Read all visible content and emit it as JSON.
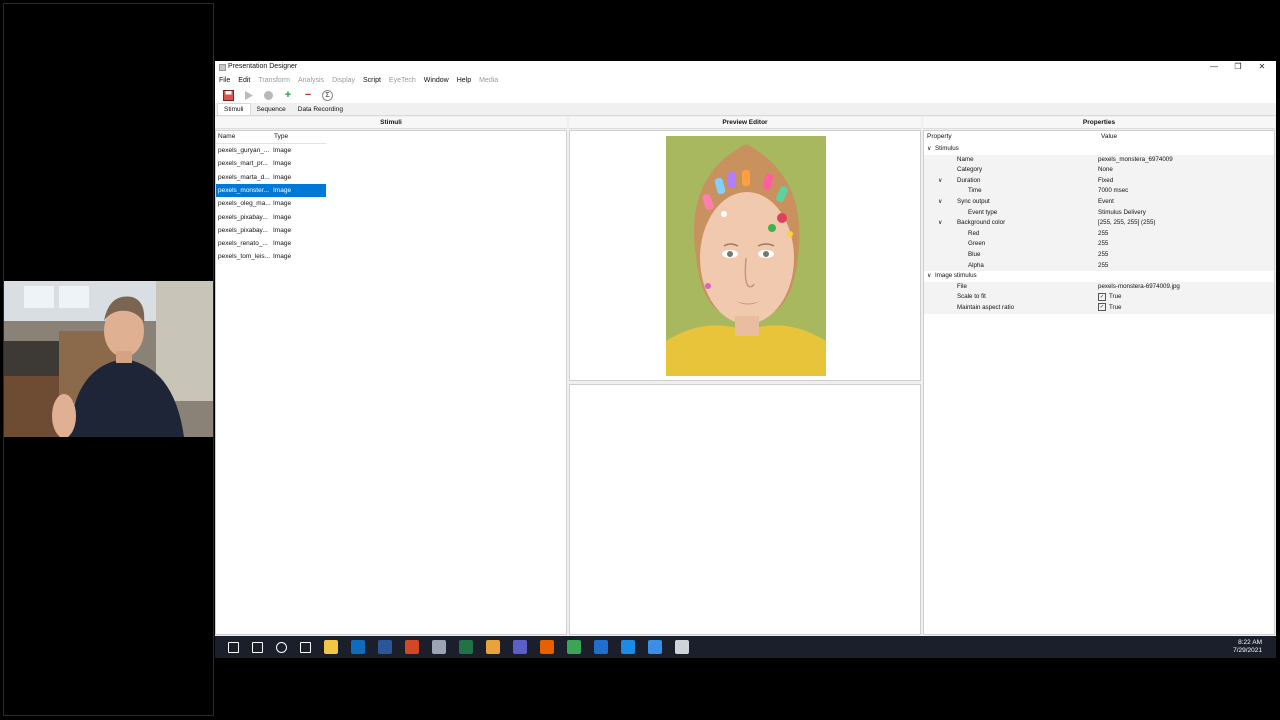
{
  "window": {
    "title": "Presentation Designer",
    "controls": [
      "—",
      "❐",
      "✕"
    ]
  },
  "menu": {
    "items": [
      {
        "label": "File",
        "enabled": true
      },
      {
        "label": "Edit",
        "enabled": true
      },
      {
        "label": "Transform",
        "enabled": false
      },
      {
        "label": "Analysis",
        "enabled": false
      },
      {
        "label": "Display",
        "enabled": false
      },
      {
        "label": "Script",
        "enabled": true
      },
      {
        "label": "EyeTech",
        "enabled": false
      },
      {
        "label": "Window",
        "enabled": true
      },
      {
        "label": "Help",
        "enabled": true
      },
      {
        "label": "Media",
        "enabled": false
      }
    ]
  },
  "toolbar": {
    "icons": [
      "save-icon",
      "play-icon",
      "record-icon",
      "add-icon",
      "remove-icon",
      "sigma-icon"
    ],
    "add_glyph": "+",
    "remove_glyph": "−",
    "sigma_glyph": "Σ"
  },
  "tabs": [
    {
      "label": "Stimuli",
      "active": true
    },
    {
      "label": "Sequence",
      "active": false
    },
    {
      "label": "Data Recording",
      "active": false
    }
  ],
  "stimuli": {
    "header": "Stimuli",
    "columns": [
      "Name",
      "Type"
    ],
    "rows": [
      {
        "name": "pexels_guryan_...",
        "type": "Image",
        "selected": false
      },
      {
        "name": "pexels_mart_pr...",
        "type": "Image",
        "selected": false
      },
      {
        "name": "pexels_marta_d...",
        "type": "Image",
        "selected": false
      },
      {
        "name": "pexels_monster...",
        "type": "Image",
        "selected": true
      },
      {
        "name": "pexels_oleg_ma...",
        "type": "Image",
        "selected": false
      },
      {
        "name": "pexels_pixabay...",
        "type": "Image",
        "selected": false
      },
      {
        "name": "pexels_pixabay...",
        "type": "Image",
        "selected": false
      },
      {
        "name": "pexels_renato_...",
        "type": "Image",
        "selected": false
      },
      {
        "name": "pexels_tom_leis...",
        "type": "Image",
        "selected": false
      }
    ]
  },
  "preview": {
    "header": "Preview Editor"
  },
  "properties": {
    "header": "Properties",
    "columns": [
      "Property",
      "Value"
    ],
    "rows": [
      {
        "label": "Stimulus",
        "value": "",
        "level": 0,
        "expander": "∨",
        "checkbox": false
      },
      {
        "label": "Name",
        "value": "pexels_monstera_6974009",
        "level": 1,
        "expander": "",
        "checkbox": false
      },
      {
        "label": "Category",
        "value": "None",
        "level": 1,
        "expander": "",
        "checkbox": false
      },
      {
        "label": "Duration",
        "value": "Fixed",
        "level": 1,
        "expander": "∨",
        "checkbox": false
      },
      {
        "label": "Time",
        "value": "7000 msec",
        "level": 2,
        "expander": "",
        "checkbox": false
      },
      {
        "label": "Sync output",
        "value": "Event",
        "level": 1,
        "expander": "∨",
        "checkbox": false
      },
      {
        "label": "Event type",
        "value": "Stimulus Delivery",
        "level": 2,
        "expander": "",
        "checkbox": false
      },
      {
        "label": "Background color",
        "value": "[255, 255, 255] (255)",
        "level": 1,
        "expander": "∨",
        "checkbox": false
      },
      {
        "label": "Red",
        "value": "255",
        "level": 2,
        "expander": "",
        "checkbox": false
      },
      {
        "label": "Green",
        "value": "255",
        "level": 2,
        "expander": "",
        "checkbox": false
      },
      {
        "label": "Blue",
        "value": "255",
        "level": 2,
        "expander": "",
        "checkbox": false
      },
      {
        "label": "Alpha",
        "value": "255",
        "level": 2,
        "expander": "",
        "checkbox": false
      },
      {
        "label": "Image stimulus",
        "value": "",
        "level": 0,
        "expander": "∨",
        "checkbox": false
      },
      {
        "label": "File",
        "value": "pexels-monstera-6974009.jpg",
        "level": 1,
        "expander": "",
        "checkbox": false
      },
      {
        "label": "Scale to fit",
        "value": "True",
        "level": 1,
        "expander": "",
        "checkbox": true
      },
      {
        "label": "Maintain aspect ratio",
        "value": "True",
        "level": 1,
        "expander": "",
        "checkbox": true
      }
    ]
  },
  "taskbar": {
    "icons": [
      {
        "name": "windows-start-icon",
        "color": "#ffffff"
      },
      {
        "name": "search-icon",
        "color": "#ffffff"
      },
      {
        "name": "cortana-icon",
        "color": "#ffffff"
      },
      {
        "name": "task-view-icon",
        "color": "#ffffff"
      },
      {
        "name": "file-explorer-icon",
        "color": "#f2c744"
      },
      {
        "name": "outlook-icon",
        "color": "#0f6cbd"
      },
      {
        "name": "word-icon",
        "color": "#2b579a"
      },
      {
        "name": "powerpoint-icon",
        "color": "#d24726"
      },
      {
        "name": "app-icon",
        "color": "#9aa4b5"
      },
      {
        "name": "excel-icon",
        "color": "#217346"
      },
      {
        "name": "chrome-icon",
        "color": "#e8a33c"
      },
      {
        "name": "teams-icon",
        "color": "#5b5fc7"
      },
      {
        "name": "firefox-icon",
        "color": "#e66000"
      },
      {
        "name": "app-green-icon",
        "color": "#3aa655"
      },
      {
        "name": "media-icon",
        "color": "#1f6fd1"
      },
      {
        "name": "edge-icon",
        "color": "#1c8be6"
      },
      {
        "name": "settings-icon",
        "color": "#3a8ee6"
      },
      {
        "name": "presentation-designer-icon",
        "color": "#cfd3da"
      }
    ],
    "time": "8:22 AM",
    "date": "7/29/2021"
  },
  "colors": {
    "selection": "#0078d7",
    "taskbar": "#1b1f2b"
  }
}
